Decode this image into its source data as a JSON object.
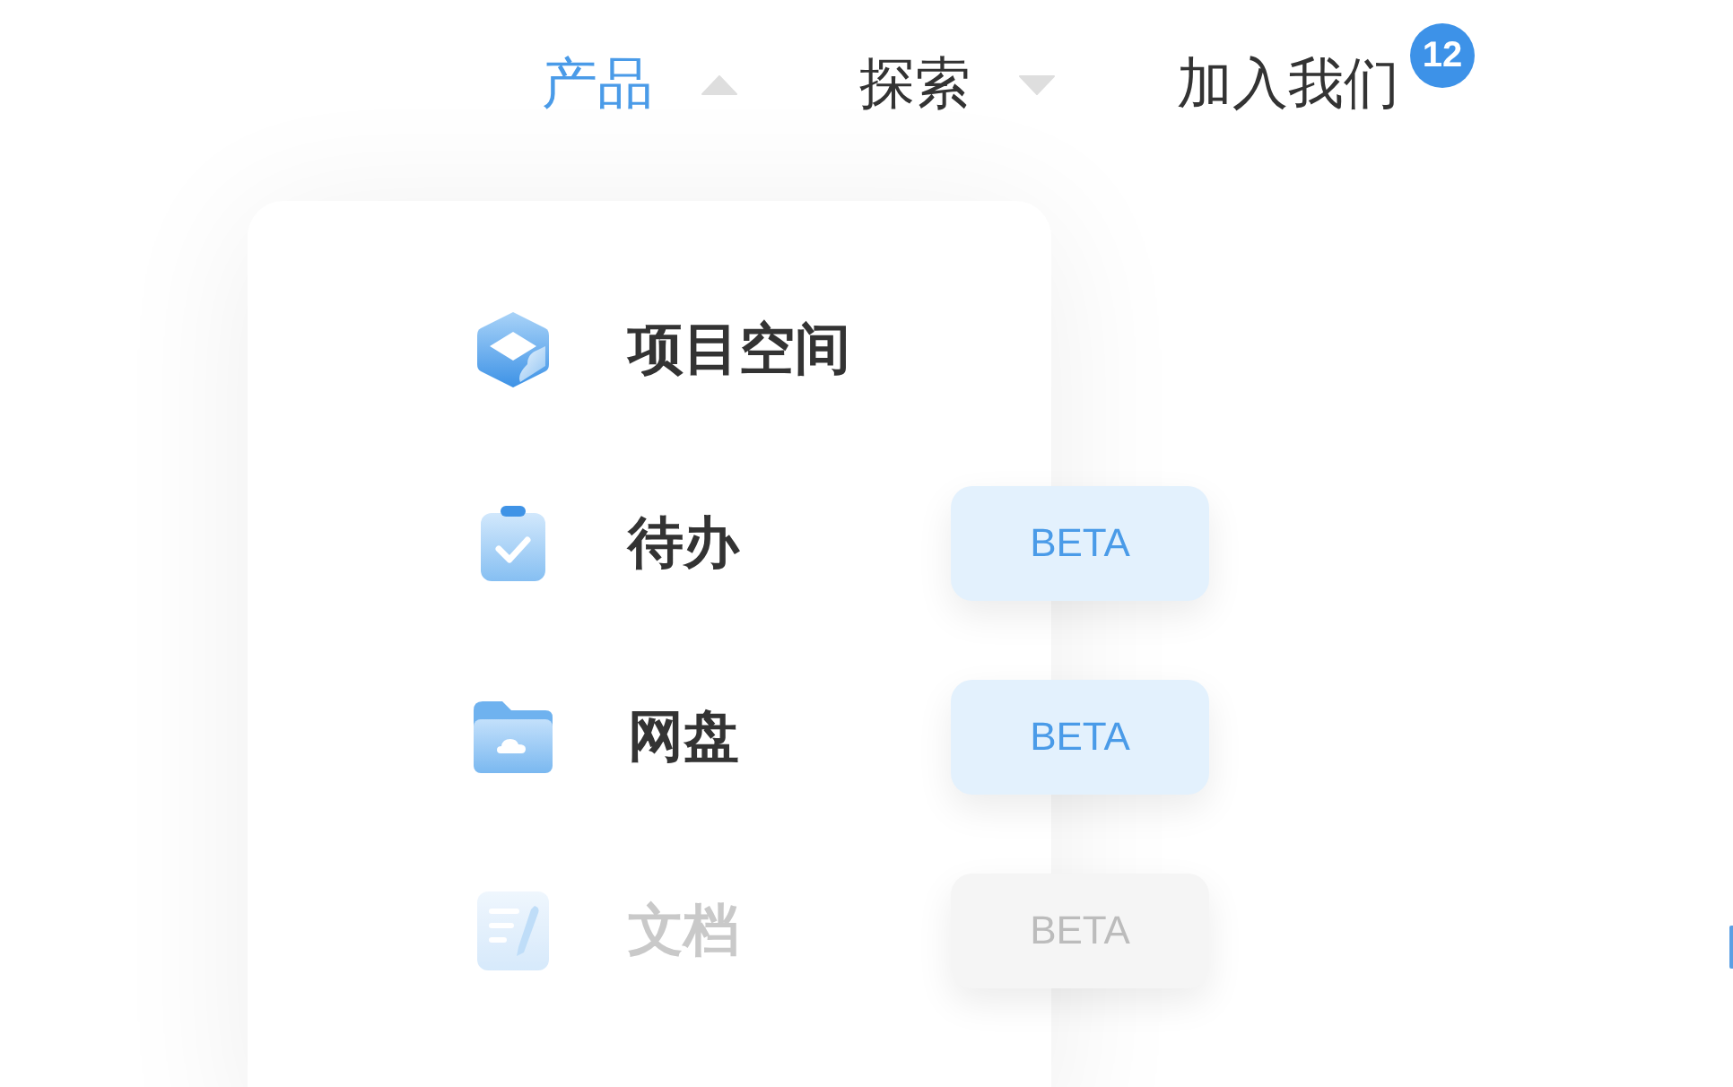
{
  "nav": [
    {
      "label": "产品",
      "kind": "dropdown",
      "selected": true,
      "expanded": true
    },
    {
      "label": "探索",
      "kind": "dropdown",
      "selected": false,
      "expanded": false
    },
    {
      "label": "加入我们",
      "kind": "link",
      "selected": false,
      "badge": "12"
    }
  ],
  "menu": [
    {
      "label": "项目空间",
      "disabled": false
    },
    {
      "label": "待办",
      "disabled": false,
      "tag": "BETA"
    },
    {
      "label": "网盘",
      "disabled": false,
      "tag": "BETA"
    },
    {
      "label": "文档",
      "disabled": true,
      "tag": "BETA"
    }
  ]
}
